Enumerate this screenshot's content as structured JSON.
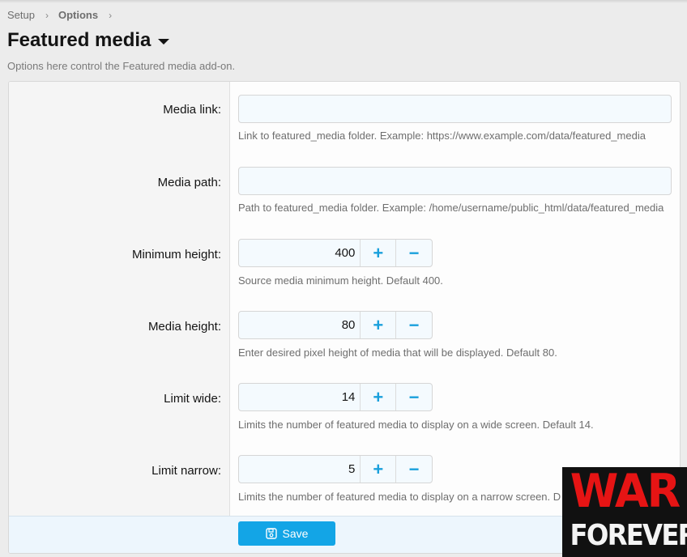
{
  "breadcrumb": {
    "items": [
      "Setup",
      "Options"
    ],
    "separator": "›"
  },
  "header": {
    "title": "Featured media",
    "description": "Options here control the Featured media add-on."
  },
  "form": {
    "media_link": {
      "label": "Media link:",
      "value": "",
      "hint": "Link to featured_media folder. Example: https://www.example.com/data/featured_media"
    },
    "media_path": {
      "label": "Media path:",
      "value": "",
      "hint": "Path to featured_media folder. Example: /home/username/public_html/data/featured_media"
    },
    "minimum_height": {
      "label": "Minimum height:",
      "value": "400",
      "hint": "Source media minimum height. Default 400."
    },
    "media_height": {
      "label": "Media height:",
      "value": "80",
      "hint": "Enter desired pixel height of media that will be displayed. Default 80."
    },
    "limit_wide": {
      "label": "Limit wide:",
      "value": "14",
      "hint": "Limits the number of featured media to display on a wide screen. Default 14."
    },
    "limit_narrow": {
      "label": "Limit narrow:",
      "value": "5",
      "hint": "Limits the number of featured media to display on a narrow screen. D"
    },
    "stepper": {
      "plus": "+",
      "minus": "−"
    }
  },
  "footer": {
    "save_label": "Save",
    "save_icon": "floppy-disk-icon"
  },
  "watermark": {
    "line1": "WAR",
    "line2": "FOREVER"
  },
  "colors": {
    "accent": "#13a5e6",
    "stepper_button": "#1aa0dc",
    "watermark_red": "#e61414"
  }
}
